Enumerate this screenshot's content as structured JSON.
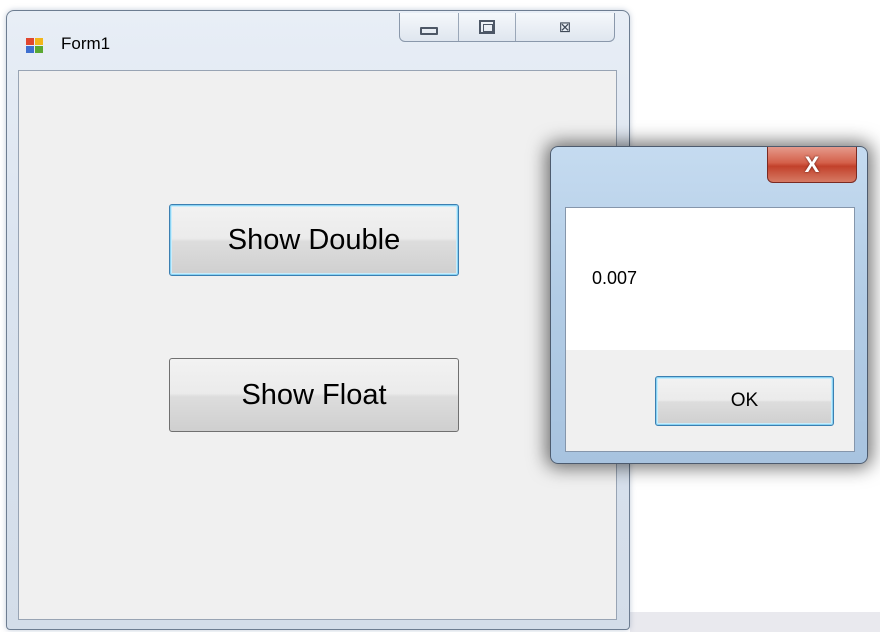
{
  "form": {
    "title": "Form1",
    "icon": "winforms-app-icon",
    "caption_buttons": [
      "minimize-icon",
      "maximize-icon",
      "close-icon"
    ],
    "close_glyph": "⊠"
  },
  "buttons": {
    "show_double": "Show Double",
    "show_float": "Show Float"
  },
  "message_box": {
    "close_glyph": "X",
    "text": "0.007",
    "ok_label": "OK"
  },
  "colors": {
    "focus_border": "#3c7fb1",
    "close_red": "#c2412b",
    "client_bg": "#f0f0f0"
  }
}
